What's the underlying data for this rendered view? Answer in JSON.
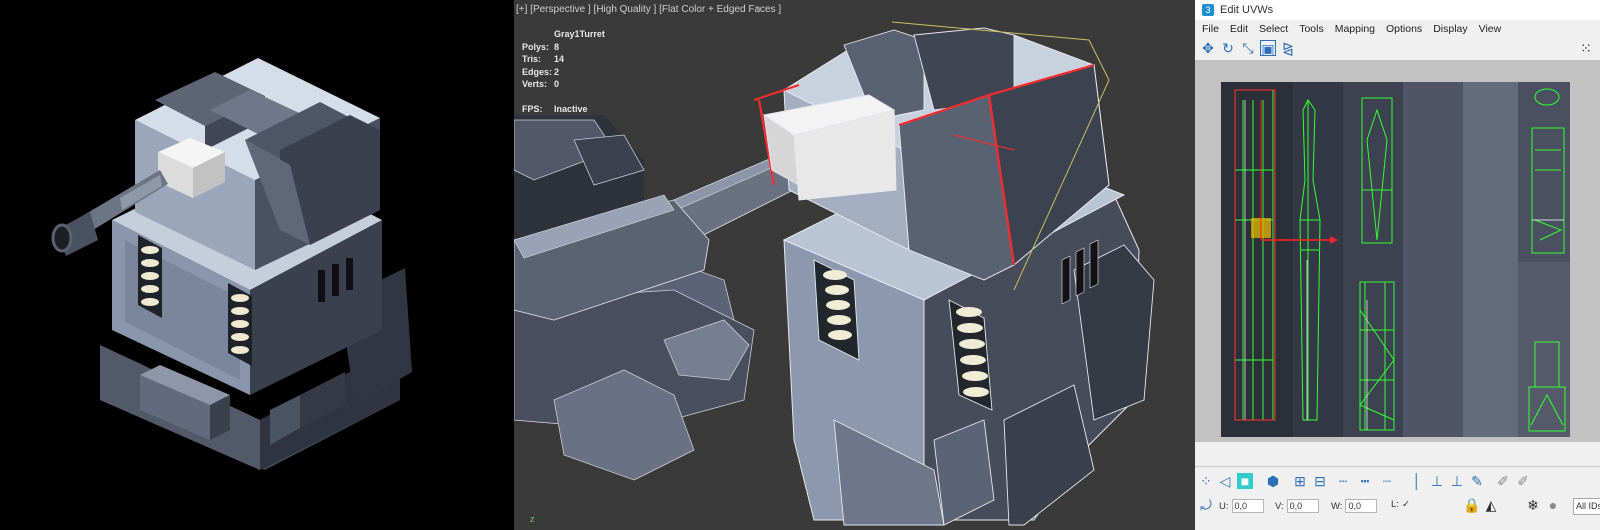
{
  "viewport": {
    "label": "[+] [Perspective ] [High Quality ] [Flat Color + Edged Faces ]",
    "filter_icon": "filter-icon",
    "object_name": "Gray1Turret",
    "stats": [
      {
        "key": "Polys:",
        "value": "8"
      },
      {
        "key": "Tris:",
        "value": "14"
      },
      {
        "key": "Edges:",
        "value": "2"
      },
      {
        "key": "Verts:",
        "value": "0"
      }
    ],
    "fps_key": "FPS:",
    "fps_value": "Inactive",
    "axis_label": "z"
  },
  "uv_editor": {
    "title": "Edit UVWs",
    "app_icon": "3",
    "menu": [
      "File",
      "Edit",
      "Select",
      "Tools",
      "Mapping",
      "Options",
      "Display",
      "View"
    ],
    "toolbar_icons": [
      "move-icon",
      "rotate-icon",
      "scale-icon",
      "freeform-icon",
      "mirror-icon"
    ],
    "bottom": {
      "u_label": "U:",
      "u_value": "0,0",
      "v_label": "V:",
      "v_value": "0,0",
      "w_label": "W:",
      "w_value": "0,0",
      "l_label": "L:",
      "ids_label": "All IDs"
    },
    "colors": {
      "uv_wire": "#33ff33",
      "selection": "#ff2222",
      "background": "#c8c8c8"
    }
  }
}
